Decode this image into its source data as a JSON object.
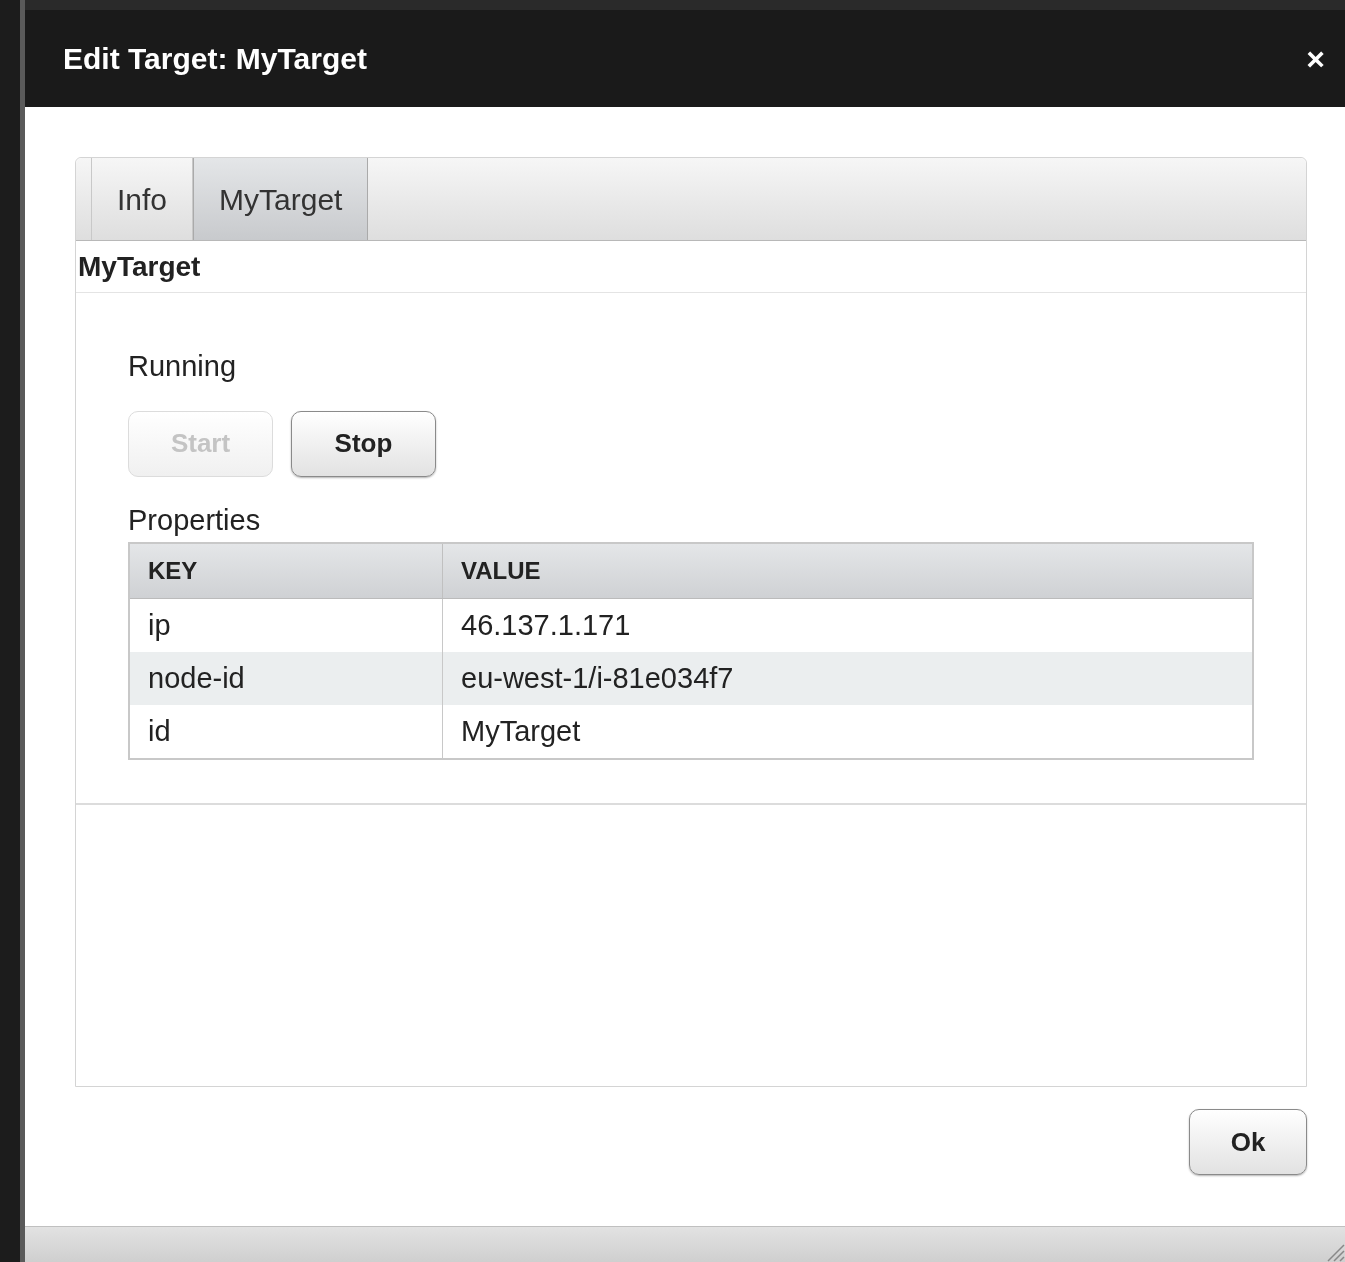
{
  "dialog": {
    "title": "Edit Target: MyTarget",
    "close": "×"
  },
  "tabs": [
    {
      "label": "Info",
      "selected": false
    },
    {
      "label": "MyTarget",
      "selected": true
    }
  ],
  "panel": {
    "heading": "MyTarget",
    "status": "Running",
    "buttons": [
      {
        "label": "Start",
        "disabled": true
      },
      {
        "label": "Stop",
        "disabled": false
      }
    ],
    "properties_label": "Properties",
    "table": {
      "columns": [
        "KEY",
        "VALUE"
      ],
      "rows": [
        [
          "ip",
          "46.137.1.171"
        ],
        [
          "node-id",
          "eu-west-1/i-81e034f7"
        ],
        [
          "id",
          "MyTarget"
        ]
      ]
    }
  },
  "footer_buttons": [
    {
      "label": "Ok",
      "disabled": false
    }
  ]
}
